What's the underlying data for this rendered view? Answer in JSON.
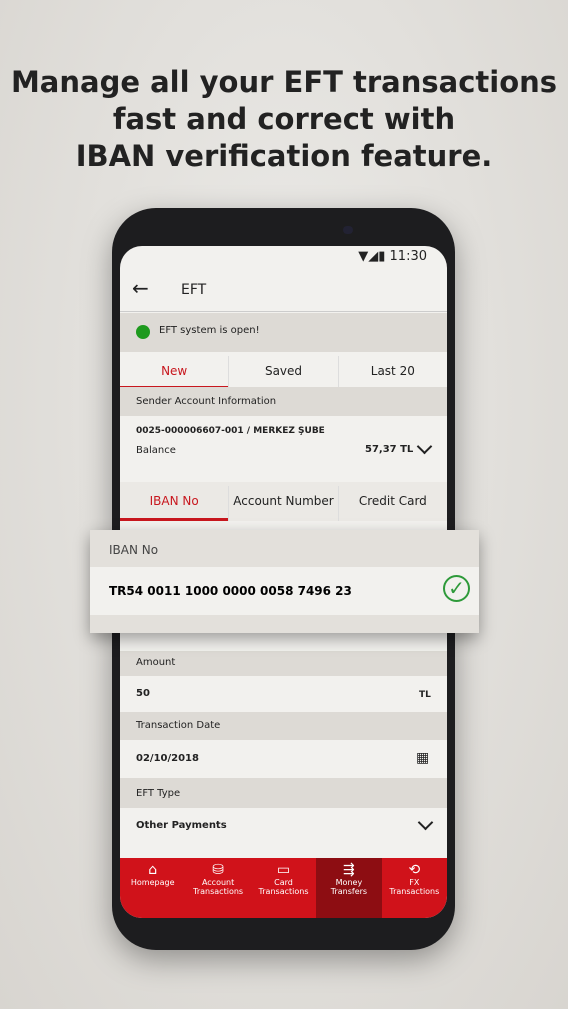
{
  "headline": [
    "Manage all your EFT transactions",
    "fast and correct with",
    "IBAN verification feature."
  ],
  "status": {
    "time": "11:30"
  },
  "header": {
    "title": "EFT"
  },
  "notice": {
    "text": "EFT system is open!",
    "color": "#1e9a1e"
  },
  "tabs": [
    {
      "label": "New",
      "active": true
    },
    {
      "label": "Saved"
    },
    {
      "label": "Last 20"
    }
  ],
  "sender": {
    "section": "Sender Account Information",
    "account": "0025-000006607-001 / MERKEZ ŞUBE",
    "balance_label": "Balance",
    "balance": "57,37 TL"
  },
  "recipient_tabs": [
    {
      "label": "IBAN No",
      "active": true
    },
    {
      "label": "Account Number"
    },
    {
      "label": "Credit Card"
    }
  ],
  "iban": {
    "label": "IBAN No",
    "value": "TR54 0011 1000 0000 0058 7496 23",
    "verified": true
  },
  "amount": {
    "label": "Amount",
    "value": "50",
    "currency": "TL"
  },
  "date": {
    "label": "Transaction Date",
    "value": "02/10/2018"
  },
  "eft_type": {
    "label": "EFT Type",
    "value": "Other Payments"
  },
  "nav": [
    {
      "l1": "Homepage",
      "l2": "",
      "icon": "home-icon"
    },
    {
      "l1": "Account",
      "l2": "Transactions",
      "icon": "coins-icon"
    },
    {
      "l1": "Card",
      "l2": "Transactions",
      "icon": "card-icon"
    },
    {
      "l1": "Money",
      "l2": "Transfers",
      "icon": "transfer-icon",
      "active": true
    },
    {
      "l1": "FX",
      "l2": "Transactions",
      "icon": "exchange-icon"
    }
  ],
  "accent": "#d0121a"
}
